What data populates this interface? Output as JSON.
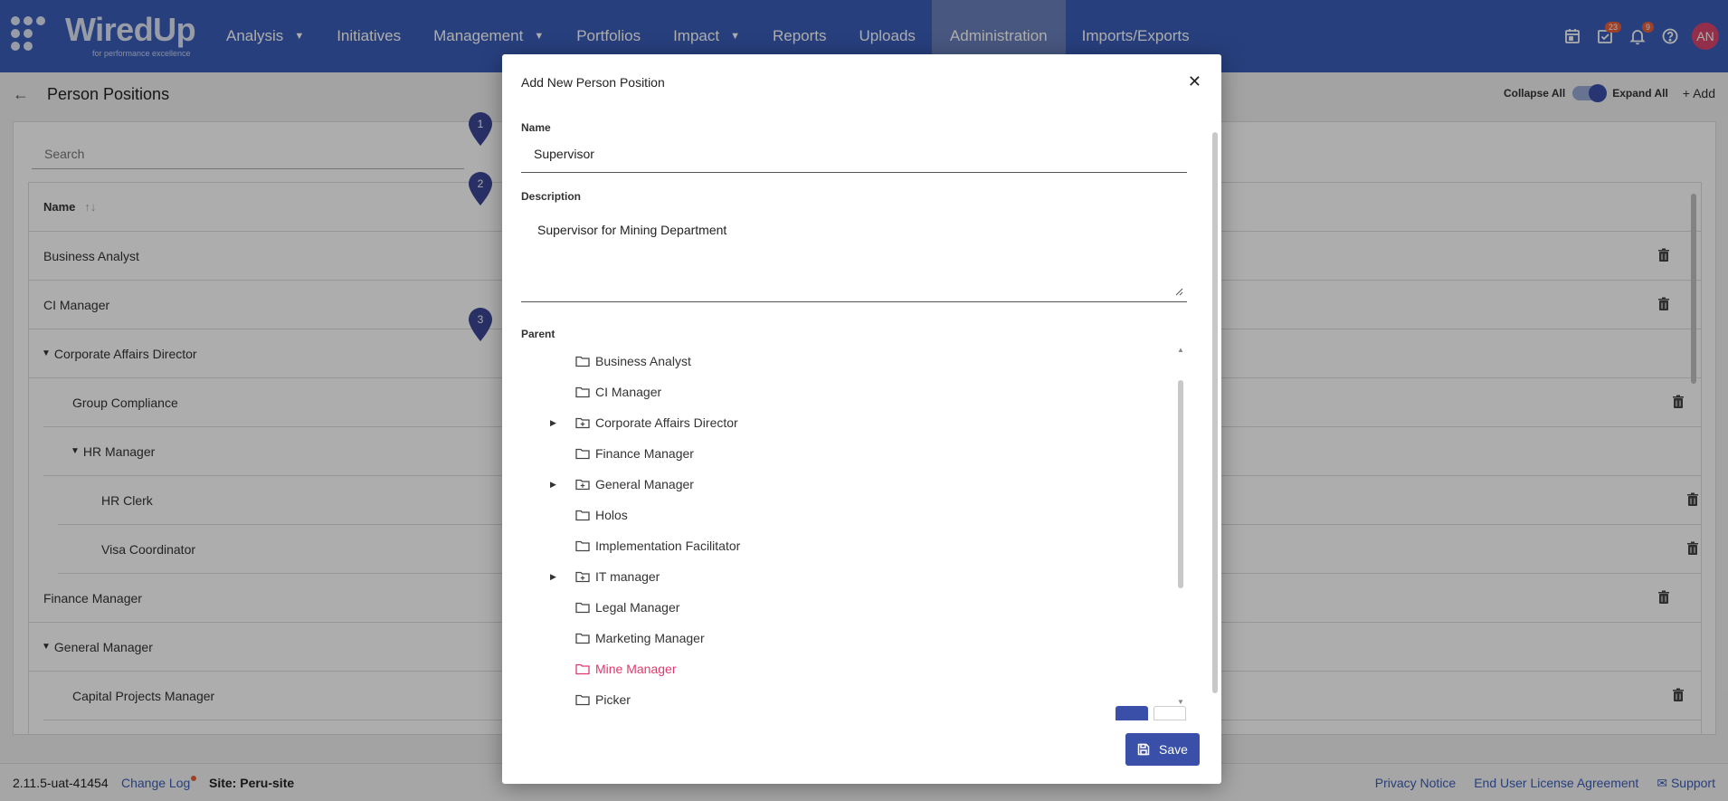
{
  "app": {
    "logo_text": "WiredUp",
    "logo_tagline": "for performance excellence"
  },
  "nav": {
    "items": [
      {
        "label": "Analysis",
        "dropdown": true
      },
      {
        "label": "Initiatives",
        "dropdown": false
      },
      {
        "label": "Management",
        "dropdown": true
      },
      {
        "label": "Portfolios",
        "dropdown": false
      },
      {
        "label": "Impact",
        "dropdown": true
      },
      {
        "label": "Reports",
        "dropdown": false
      },
      {
        "label": "Uploads",
        "dropdown": false
      },
      {
        "label": "Administration",
        "dropdown": false,
        "active": true
      },
      {
        "label": "Imports/Exports",
        "dropdown": false
      }
    ],
    "tasks_badge": "23",
    "notifications_badge": "9",
    "avatar_initials": "AN"
  },
  "page": {
    "title": "Person Positions",
    "collapse_all_label": "Collapse All",
    "expand_all_label": "Expand All",
    "add_label": "+ Add",
    "search_placeholder": "Search",
    "name_column_header": "Name",
    "rows": [
      {
        "label": "Business Analyst",
        "level": 0,
        "expanded": null,
        "deletable": true
      },
      {
        "label": "CI Manager",
        "level": 0,
        "expanded": null,
        "deletable": true
      },
      {
        "label": "Corporate Affairs Director",
        "level": 0,
        "expanded": true,
        "deletable": false
      },
      {
        "label": "Group Compliance",
        "level": 1,
        "expanded": null,
        "deletable": true
      },
      {
        "label": "HR Manager",
        "level": 1,
        "expanded": true,
        "deletable": false
      },
      {
        "label": "HR Clerk",
        "level": 2,
        "expanded": null,
        "deletable": true
      },
      {
        "label": "Visa Coordinator",
        "level": 2,
        "expanded": null,
        "deletable": true
      },
      {
        "label": "Finance Manager",
        "level": 0,
        "expanded": null,
        "deletable": true
      },
      {
        "label": "General Manager",
        "level": 0,
        "expanded": true,
        "deletable": false
      },
      {
        "label": "Capital Projects Manager",
        "level": 1,
        "expanded": null,
        "deletable": true
      }
    ],
    "markers": [
      "1",
      "2",
      "3"
    ]
  },
  "modal": {
    "title": "Add New Person Position",
    "name_label": "Name",
    "name_value": "Supervisor",
    "description_label": "Description",
    "description_value": "Supervisor for Mining Department",
    "parent_label": "Parent",
    "parent_tree": [
      {
        "label": "Business Analyst",
        "has_children": false,
        "selected": false
      },
      {
        "label": "CI Manager",
        "has_children": false,
        "selected": false
      },
      {
        "label": "Corporate Affairs Director",
        "has_children": true,
        "selected": false
      },
      {
        "label": "Finance Manager",
        "has_children": false,
        "selected": false
      },
      {
        "label": "General Manager",
        "has_children": true,
        "selected": false
      },
      {
        "label": "Holos",
        "has_children": false,
        "selected": false
      },
      {
        "label": "Implementation Facilitator",
        "has_children": false,
        "selected": false
      },
      {
        "label": "IT manager",
        "has_children": true,
        "selected": false
      },
      {
        "label": "Legal Manager",
        "has_children": false,
        "selected": false
      },
      {
        "label": "Marketing Manager",
        "has_children": false,
        "selected": false
      },
      {
        "label": "Mine Manager",
        "has_children": false,
        "selected": true
      },
      {
        "label": "Picker",
        "has_children": false,
        "selected": false
      }
    ],
    "save_label": "Save"
  },
  "footer": {
    "version": "2.11.5-uat-41454",
    "change_log": "Change Log",
    "site": "Site: Peru-site",
    "privacy": "Privacy Notice",
    "eula": "End User License Agreement",
    "support": "Support"
  },
  "colors": {
    "brand": "#3a5db8",
    "nav_active": "#6b80bd",
    "primary_button": "#3a4fa8",
    "selected_tree_item": "#e0386e",
    "avatar": "#d9446f",
    "badge": "#e8603c",
    "marker": "#3b4797"
  }
}
